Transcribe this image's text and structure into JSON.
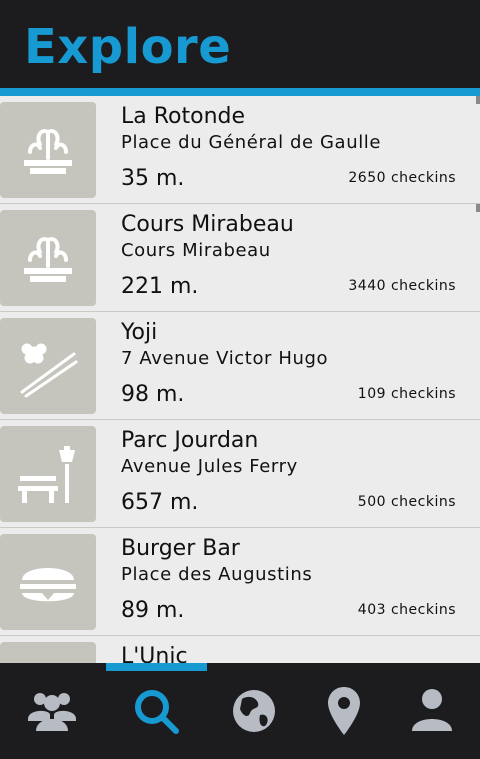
{
  "header": {
    "title": "Explore"
  },
  "colors": {
    "accent": "#1799d2",
    "tab_inactive": "#b7bcc4",
    "thumb_bg": "#c6c5bd"
  },
  "places": [
    {
      "name": "La Rotonde",
      "address": "Place du Général de Gaulle",
      "distance": "35 m.",
      "checkins": "2650 checkins",
      "icon": "fountain-icon"
    },
    {
      "name": "Cours Mirabeau",
      "address": "Cours Mirabeau",
      "distance": "221 m.",
      "checkins": "3440 checkins",
      "icon": "fountain-icon"
    },
    {
      "name": "Yoji",
      "address": "7 Avenue Victor Hugo",
      "distance": "98 m.",
      "checkins": "109 checkins",
      "icon": "sushi-icon"
    },
    {
      "name": "Parc Jourdan",
      "address": "Avenue Jules Ferry",
      "distance": "657 m.",
      "checkins": "500 checkins",
      "icon": "park-icon"
    },
    {
      "name": "Burger Bar",
      "address": "Place des Augustins",
      "distance": "89 m.",
      "checkins": "403 checkins",
      "icon": "burger-icon"
    },
    {
      "name": "L'Unic",
      "address": "",
      "distance": "",
      "checkins": "",
      "icon": "bar-icon"
    }
  ],
  "tabs": [
    {
      "icon": "people-icon",
      "active": false
    },
    {
      "icon": "search-icon",
      "active": true
    },
    {
      "icon": "globe-icon",
      "active": false
    },
    {
      "icon": "map-pin-icon",
      "active": false
    },
    {
      "icon": "user-icon",
      "active": false
    }
  ]
}
